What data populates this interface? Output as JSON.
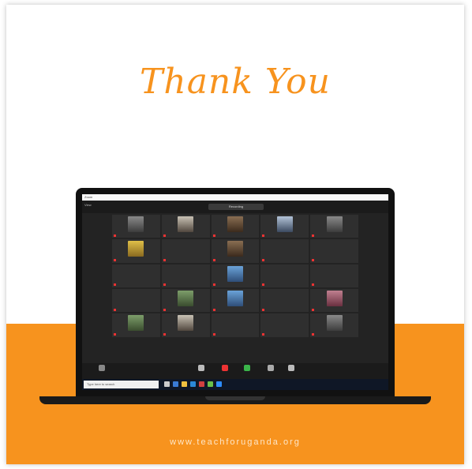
{
  "title": "Thank You",
  "url": "www.teachforuganda.org",
  "colors": {
    "accent": "#f7931e",
    "white": "#ffffff"
  },
  "meeting": {
    "window_title": "Zoom",
    "view_label": "View",
    "recording_label": "Recording"
  },
  "tiles": [
    {
      "name": "",
      "photo": "p0"
    },
    {
      "name": "",
      "photo": "p1"
    },
    {
      "name": "",
      "photo": "p4"
    },
    {
      "name": "",
      "photo": "p5"
    },
    {
      "name": "",
      "photo": "p0"
    },
    {
      "name": "",
      "photo": "p2"
    },
    {
      "name": ""
    },
    {
      "name": "",
      "photo": "p4"
    },
    {
      "name": ""
    },
    {
      "name": "",
      "big": ""
    },
    {
      "name": "",
      "big": ""
    },
    {
      "name": "",
      "big": ""
    },
    {
      "name": "",
      "photo": "p3"
    },
    {
      "name": "",
      "big": ""
    },
    {
      "name": "",
      "big": ""
    },
    {
      "name": "",
      "big": ""
    },
    {
      "name": "",
      "photo": "p6"
    },
    {
      "name": "",
      "photo": "p3"
    },
    {
      "name": "",
      "big": ""
    },
    {
      "name": "",
      "photo": "p7"
    },
    {
      "name": "",
      "photo": "p6"
    },
    {
      "name": "",
      "photo": "p1"
    },
    {
      "name": "",
      "big": ""
    },
    {
      "name": "",
      "big": ""
    },
    {
      "name": "",
      "photo": "p0"
    }
  ],
  "toolbar": {
    "items": [
      {
        "label": "",
        "icon": "camera-icon"
      },
      {
        "label": "",
        "icon": "participants-icon"
      },
      {
        "label": "",
        "icon": "chat-icon"
      },
      {
        "label": "",
        "icon": "share-screen-icon"
      },
      {
        "label": "",
        "icon": "record-icon"
      },
      {
        "label": "",
        "icon": "reactions-icon"
      }
    ],
    "end_label": ""
  },
  "taskbar": {
    "search_placeholder": "Type here to search",
    "tray_text": ""
  }
}
